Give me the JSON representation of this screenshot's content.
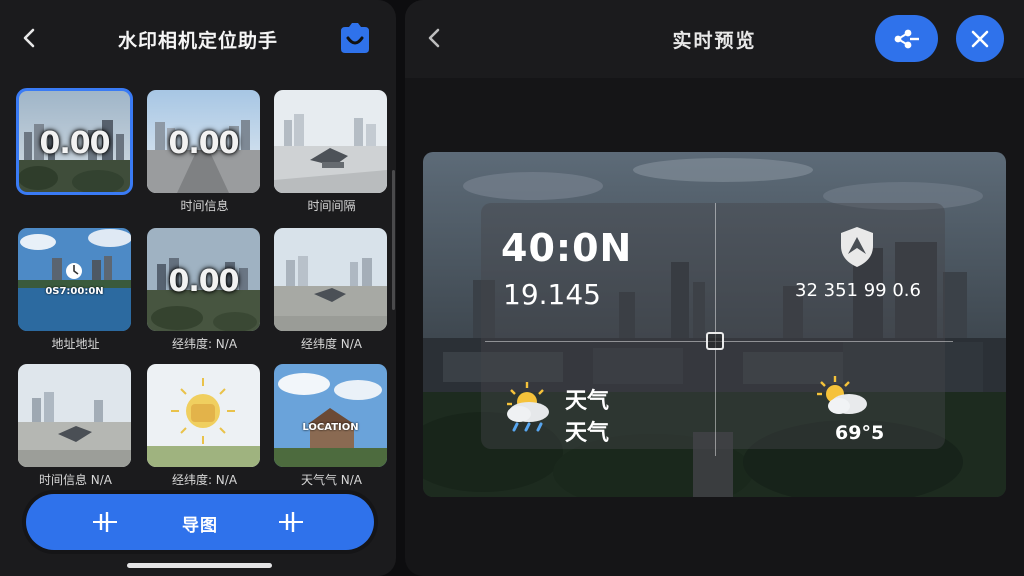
{
  "left": {
    "title": "水印相机定位助手",
    "tiles": [
      {
        "overlay": "0.00",
        "label": "",
        "selected": true
      },
      {
        "overlay": "0.00",
        "label": "时间信息",
        "selected": false
      },
      {
        "overlay": "",
        "label": "时间间隔",
        "selected": false
      },
      {
        "overlay": "",
        "overlay_small": "0S7:00:0N",
        "label": "地址地址",
        "selected": false
      },
      {
        "overlay": "0.00",
        "label": "经纬度: N/A",
        "selected": false
      },
      {
        "overlay": "",
        "label": "经纬度 N/A",
        "selected": false
      },
      {
        "overlay": "",
        "label": "时间信息 N/A",
        "selected": false
      },
      {
        "overlay": "",
        "label": "经纬度: N/A",
        "selected": false
      },
      {
        "overlay": "",
        "overlay_small": "LOCATION",
        "label": "天气气 N/A",
        "selected": false
      }
    ],
    "bottom_label": "导图"
  },
  "right": {
    "title": "实时预览",
    "watermark": {
      "coord_main": "40:0N",
      "coord_sub": "19.145",
      "altitude": "32 351 99 0.6",
      "weather_line1": "天气",
      "weather_line2": "天气",
      "temperature": "69°5"
    }
  },
  "colors": {
    "accent": "#2f72eb",
    "panel": "#1b1b1d"
  },
  "icons": [
    "back-arrow-icon",
    "camera-shield-icon",
    "share-icon",
    "close-icon",
    "tune-icon",
    "shield-badge-icon",
    "rain-weather-icon",
    "partly-cloudy-icon"
  ]
}
